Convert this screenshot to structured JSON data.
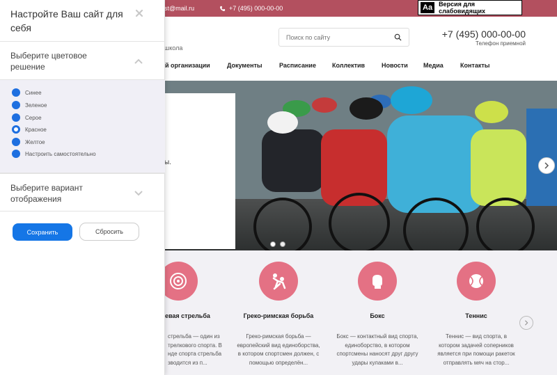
{
  "topbar": {
    "email": "st@mail.ru",
    "phone": "+7 (495) 000-00-00",
    "impaired_icon": "Aa",
    "impaired_label": "Версия для слабовидящих"
  },
  "header": {
    "school_tail": "школа",
    "search_placeholder": "Поиск по сайту",
    "phone": "+7 (495) 000-00-00",
    "phone_caption": "Телефон приемной"
  },
  "nav": {
    "items": [
      "й организации",
      "Документы",
      "Расписание",
      "Коллектив",
      "Новости",
      "Медиа",
      "Контакты"
    ]
  },
  "hero": {
    "card_text": "ы.",
    "slides_total": 2,
    "slide_active": 1
  },
  "sports": {
    "items": [
      {
        "icon": "target-icon",
        "title": "евая стрельба",
        "desc": [
          "стрельба — один из",
          "трелкового спорта. В",
          "нде спорта стрельба",
          "зводится из п..."
        ]
      },
      {
        "icon": "wrestling-icon",
        "title": "Греко-римская борьба",
        "desc": [
          "Греко-римская борьба —",
          "европейский вид единоборства,",
          "в котором спортсмен должен, с",
          "помощью определён..."
        ]
      },
      {
        "icon": "boxing-glove-icon",
        "title": "Бокс",
        "desc": [
          "Бокс — контактный вид спорта,",
          "единоборство, в котором",
          "спортсмены наносят друг другу",
          "удары кулаками в..."
        ]
      },
      {
        "icon": "tennis-ball-icon",
        "title": "Теннис",
        "desc": [
          "Теннис — вид спорта, в",
          "котором задачей соперников",
          "является при помощи ракеток",
          "отправлять мяч на стор..."
        ]
      }
    ]
  },
  "panel": {
    "title": "Настройте Ваш сайт для себя",
    "color_section_label": "Выберите цветовое решение",
    "display_section_label": "Выберите вариант отображения",
    "color_options": [
      "Синее",
      "Зеленое",
      "Серое",
      "Красное",
      "Желтое",
      "Настроить самостоятельно"
    ],
    "selected_color_index": 3,
    "save_label": "Сохранить",
    "reset_label": "Сбросить"
  },
  "colors": {
    "accent": "#b3505f",
    "sport_circle": "#e47184",
    "radio": "#1e6fe0",
    "save_button": "#1576e6"
  }
}
